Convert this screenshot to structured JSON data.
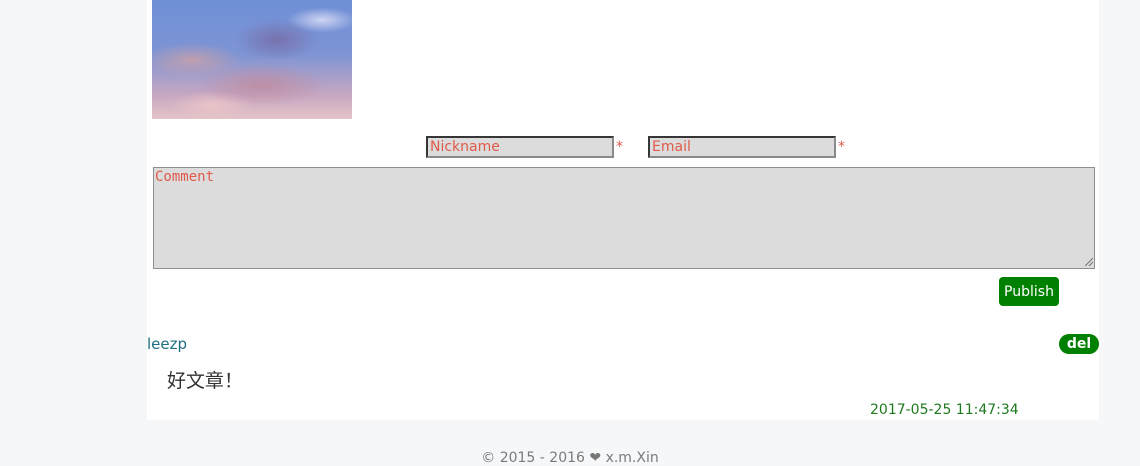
{
  "form": {
    "nickname_placeholder": "Nickname",
    "email_placeholder": "Email",
    "required_mark": "*",
    "comment_placeholder": "Comment",
    "publish_label": "Publish"
  },
  "comment": {
    "author": "leezp",
    "delete_label": "del",
    "text": "好文章！",
    "timestamp": "2017-05-25 11:47:34"
  },
  "footer": {
    "years": "© 2015 - 2016",
    "heart_icon": "heart-icon",
    "author": "x.m.Xin"
  },
  "colors": {
    "accent_green": "#008000",
    "placeholder_red": "#e05a4a",
    "author_link": "#1c6f80",
    "field_bg": "#dcdcdc"
  }
}
